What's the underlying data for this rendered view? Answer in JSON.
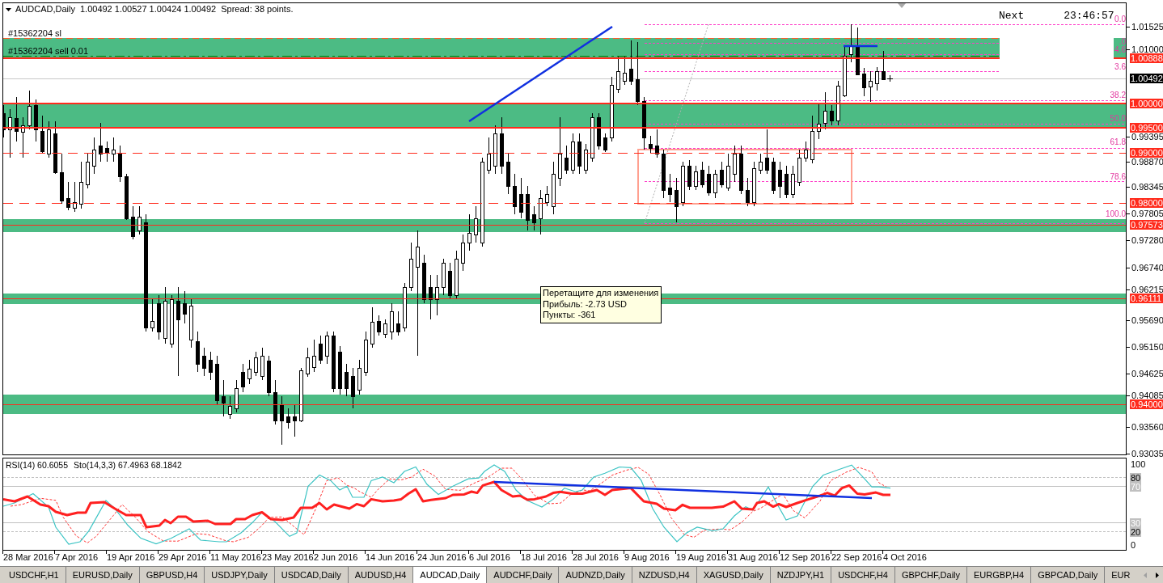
{
  "chart": {
    "header": {
      "symbol": "AUDCAD,Daily",
      "ohlc": "1.00492 1.00527 1.00424 1.00492",
      "spread": "Spread: 38 points."
    },
    "order_labels": [
      "#15362204 sl",
      "#15362204 sell 0.01"
    ],
    "countdown": {
      "label": "Next",
      "time": "23:46:57"
    },
    "fib_labels": [
      "0.0",
      ".0",
      "4.6",
      "3.6",
      "38.2",
      "50.0",
      "61.8",
      "78.6",
      "100.0"
    ],
    "tooltip": [
      "Перетащите для изменения",
      "Прибыль: -2.73 USD",
      "Пункты: -361"
    ],
    "price_axis": [
      {
        "kind": "tick",
        "text": "1.01525"
      },
      {
        "kind": "tick",
        "text": "1.01000"
      },
      {
        "kind": "line",
        "text": "1.00888"
      },
      {
        "kind": "bid",
        "text": "1.00492"
      },
      {
        "kind": "line",
        "text": "1.00000"
      },
      {
        "kind": "line",
        "text": "0.99500"
      },
      {
        "kind": "tick",
        "text": "0.99395"
      },
      {
        "kind": "line",
        "text": "0.99000"
      },
      {
        "kind": "tick",
        "text": "0.98870"
      },
      {
        "kind": "tick",
        "text": "0.98345"
      },
      {
        "kind": "line",
        "text": "0.98000"
      },
      {
        "kind": "tick",
        "text": "0.97805"
      },
      {
        "kind": "line",
        "text": "0.97573"
      },
      {
        "kind": "tick",
        "text": "0.97280"
      },
      {
        "kind": "tick",
        "text": "0.96740"
      },
      {
        "kind": "tick",
        "text": "0.96215"
      },
      {
        "kind": "line",
        "text": "0.96111"
      },
      {
        "kind": "tick",
        "text": "0.95690"
      },
      {
        "kind": "tick",
        "text": "0.95150"
      },
      {
        "kind": "tick",
        "text": "0.94625"
      },
      {
        "kind": "tick",
        "text": "0.94085"
      },
      {
        "kind": "line",
        "text": "0.94000"
      },
      {
        "kind": "tick",
        "text": "0.93560"
      },
      {
        "kind": "tick",
        "text": "0.93035"
      }
    ]
  },
  "indicator": {
    "labels": [
      "RSI(14) 60.6055",
      "Sto(14,3,3) 67.4963 68.1842"
    ],
    "scale": [
      {
        "kind": "plain",
        "text": "100"
      },
      {
        "kind": "stochastic",
        "text": "80"
      },
      {
        "kind": "rsi",
        "text": "70"
      },
      {
        "kind": "rsi",
        "text": "30"
      },
      {
        "kind": "stochastic",
        "text": "20"
      },
      {
        "kind": "plain",
        "text": "0"
      }
    ]
  },
  "date_axis": [
    "28 Mar 2016",
    "7 Apr 2016",
    "19 Apr 2016",
    "29 Apr 2016",
    "11 May 2016",
    "23 May 2016",
    "2 Jun 2016",
    "14 Jun 2016",
    "24 Jun 2016",
    "6 Jul 2016",
    "18 Jul 2016",
    "28 Jul 2016",
    "9 Aug 2016",
    "19 Aug 2016",
    "31 Aug 2016",
    "12 Sep 2016",
    "22 Sep 2016",
    "4 Oct 2016"
  ],
  "tabs": [
    {
      "label": "USDCHF,H1",
      "selected": false
    },
    {
      "label": "EURUSD,Daily",
      "selected": false
    },
    {
      "label": "GBPUSD,H4",
      "selected": false
    },
    {
      "label": "USDJPY,Daily",
      "selected": false
    },
    {
      "label": "USDCAD,Daily",
      "selected": false
    },
    {
      "label": "AUDUSD,H4",
      "selected": false
    },
    {
      "label": "AUDCAD,Daily",
      "selected": true
    },
    {
      "label": "AUDCHF,Daily",
      "selected": false
    },
    {
      "label": "AUDNZD,Daily",
      "selected": false
    },
    {
      "label": "NZDUSD,H4",
      "selected": false
    },
    {
      "label": "XAGUSD,Daily",
      "selected": false
    },
    {
      "label": "NZDJPY,H1",
      "selected": false
    },
    {
      "label": "USDCHF,H4",
      "selected": false
    },
    {
      "label": "GBPCHF,Daily",
      "selected": false
    },
    {
      "label": "EURGBP,H4",
      "selected": false
    },
    {
      "label": "GBPCAD,Daily",
      "selected": false
    },
    {
      "label": "EUR",
      "selected": false
    }
  ],
  "tab_scroll": [
    {
      "kind": "left",
      "disabled": true
    },
    {
      "kind": "right",
      "disabled": false
    }
  ]
}
